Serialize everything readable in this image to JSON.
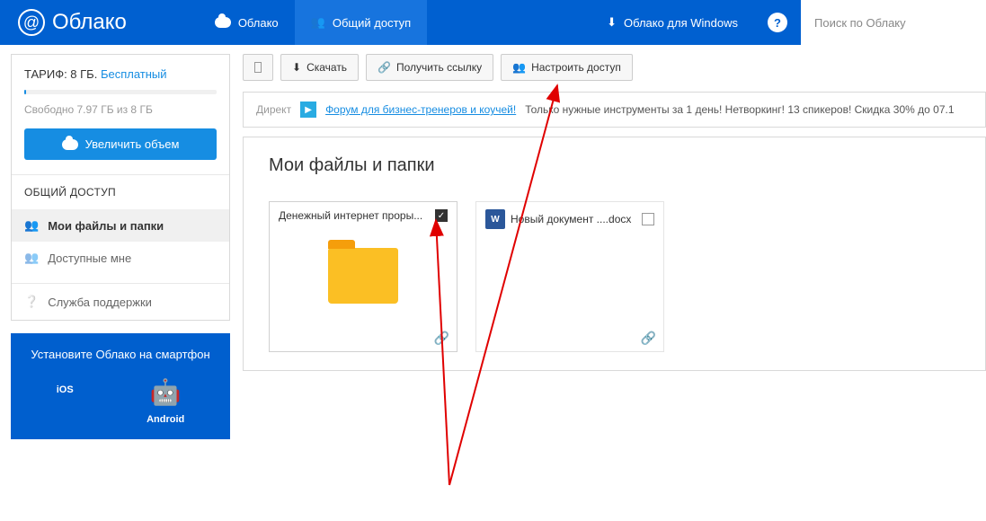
{
  "header": {
    "logo_text": "Облако",
    "nav": {
      "cloud": "Облако",
      "shared": "Общий доступ",
      "windows": "Облако для Windows"
    },
    "search_placeholder": "Поиск по Облаку"
  },
  "sidebar": {
    "tariff": {
      "label": "ТАРИФ: 8 ГБ.",
      "plan": "Бесплатный",
      "free_space": "Свободно 7.97 ГБ из 8 ГБ",
      "upgrade_button": "Увеличить объем"
    },
    "shared_section_title": "ОБЩИЙ ДОСТУП",
    "menu": {
      "my_files": "Мои файлы и папки",
      "available": "Доступные мне"
    },
    "support": "Служба поддержки",
    "promo": {
      "title": "Установите Облако на смартфон",
      "ios": "iOS",
      "android": "Android"
    }
  },
  "toolbar": {
    "download": "Скачать",
    "get_link": "Получить ссылку",
    "configure_access": "Настроить доступ"
  },
  "ad": {
    "label": "Директ",
    "link": "Форум для бизнес-тренеров и коучей!",
    "text": "Только нужные инструменты за 1 день! Нетворкинг! 13 спикеров! Скидка 30% до 07.1"
  },
  "content": {
    "title": "Мои файлы и папки",
    "files": [
      {
        "name": "Денежный интернет проры...",
        "type": "folder",
        "checked": true,
        "link": true
      },
      {
        "name": "Новый документ ....docx",
        "type": "doc",
        "checked": false,
        "link": true
      }
    ]
  }
}
